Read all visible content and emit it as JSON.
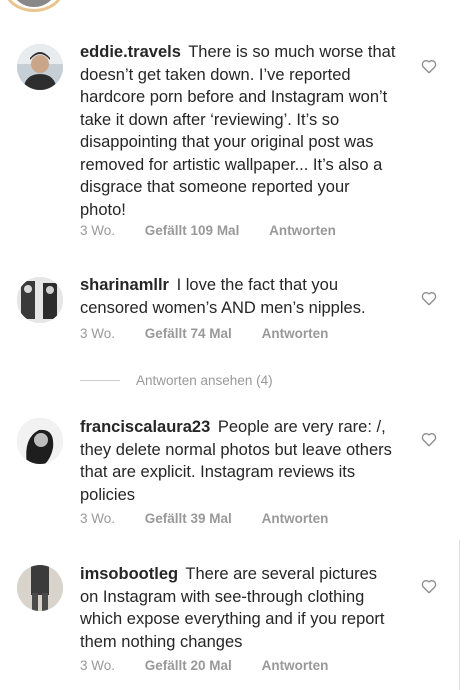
{
  "comments": [
    {
      "username": "eddie.travels",
      "text": "There is so much worse that doesn’t get taken down. I’ve reported hardcore porn before and Instagram won’t take it down after ‘reviewing’. It’s so disappointing that your original post was removed for artistic wallpaper... It’s also a disgrace that someone reported your photo!",
      "time": "3 Wo.",
      "likes": "Gefällt 109 Mal",
      "reply": "Antworten"
    },
    {
      "username": "sharinamllr",
      "text": "I love the fact that you censored women’s AND men’s nipples.",
      "time": "3 Wo.",
      "likes": "Gefällt 74 Mal",
      "reply": "Antworten"
    },
    {
      "username": "franciscalaura23",
      "text": "People are very rare: /, they delete normal photos but leave others that are explicit. Instagram reviews its policies",
      "time": "3 Wo.",
      "likes": "Gefällt 39 Mal",
      "reply": "Antworten"
    },
    {
      "username": "imsobootleg",
      "text": "There are several pictures on Instagram with see-through clothing which expose everything and if you report them nothing changes",
      "time": "3 Wo.",
      "likes": "Gefällt 20 Mal",
      "reply": "Antworten"
    }
  ],
  "view_replies": "Antworten ansehen (4)",
  "icons": {
    "like": "heart-outline-icon"
  },
  "colors": {
    "meta": "#999999",
    "text": "#262626"
  }
}
